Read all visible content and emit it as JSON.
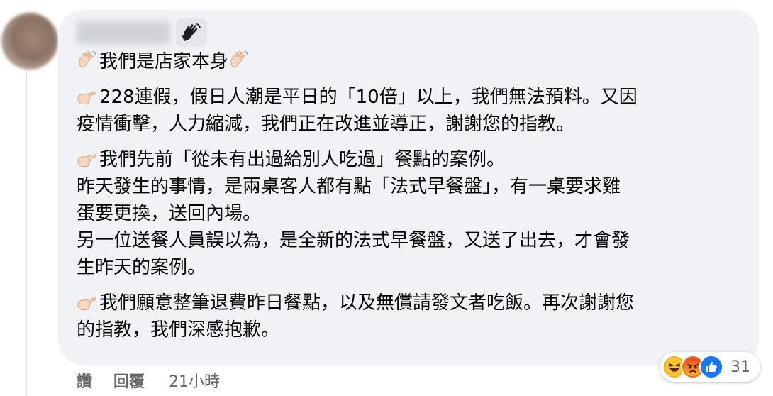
{
  "comment": {
    "intro": "我們是店家本身",
    "paragraphs": [
      {
        "lines": [
          "228連假，假日人潮是平日的「10倍」以上，我們無法預料。又因",
          "疫情衝擊，人力縮減，我們正在改進並導正，謝謝您的指教。"
        ]
      },
      {
        "lines": [
          "我們先前「從未有出過給別人吃過」餐點的案例。",
          "昨天發生的事情，是兩桌客人都有點「法式早餐盤」，有一桌要求雞",
          "蛋要更換，送回內場。",
          "另一位送餐人員誤以為，是全新的法式早餐盤，又送了出去，才會發",
          "生昨天的案例。"
        ]
      },
      {
        "lines": [
          "我們願意整筆退費昨日餐點，以及無償請發文者吃飯。再次謝謝您",
          "的指教，我們深感抱歉。"
        ]
      }
    ]
  },
  "actions": {
    "like": "讚",
    "reply": "回覆",
    "time": "21小時"
  },
  "reactions": {
    "icons": [
      "haha-icon",
      "angry-icon",
      "like-icon"
    ],
    "count": "31"
  },
  "colors": {
    "bubble": "#f0f2f5",
    "secondary_text": "#65676b",
    "like_blue": "#1877f2",
    "angry_red": "#e9710f",
    "haha_yellow": "#f7b125"
  }
}
